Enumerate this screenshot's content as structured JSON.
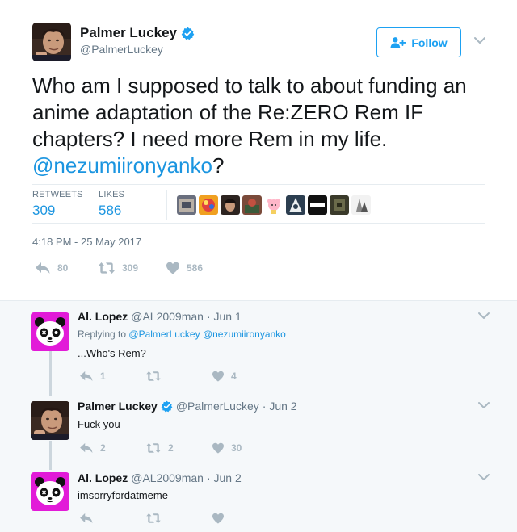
{
  "tweet": {
    "author_name": "Palmer Luckey",
    "author_handle": "@PalmerLuckey",
    "follow_label": "Follow",
    "text_part1": "Who am I supposed to talk to about funding an anime adaptation of the Re:ZERO Rem IF chapters? I need more Rem in my life. ",
    "mention": "@nezumiironyanko",
    "text_part2": "?",
    "retweets_label": "RETWEETS",
    "retweets_count": "309",
    "likes_label": "LIKES",
    "likes_count": "586",
    "timestamp": "4:18 PM - 25 May 2017",
    "reply_count": "80",
    "retweet_count_action": "309",
    "like_count_action": "586"
  },
  "replies": [
    {
      "name": "Al. Lopez",
      "handle": "@AL2009man",
      "date": "· Jun 1",
      "replying_prefix": "Replying to",
      "replying_to": "@PalmerLuckey @nezumiironyanko",
      "text": "...Who's Rem?",
      "reply_count": "1",
      "retweet_count": "",
      "like_count": "4"
    },
    {
      "name": "Palmer Luckey",
      "handle": "@PalmerLuckey",
      "date": "· Jun 2",
      "text": "Fuck you",
      "reply_count": "2",
      "retweet_count": "2",
      "like_count": "30"
    },
    {
      "name": "Al. Lopez",
      "handle": "@AL2009man",
      "date": "· Jun 2",
      "text": "imsorryfordatmeme",
      "reply_count": "",
      "retweet_count": "",
      "like_count": ""
    }
  ],
  "colors": {
    "brand_blue": "#1da1f2",
    "link_blue": "#1b95e0",
    "muted_gray": "#657786",
    "action_gray": "#aab8c2",
    "panda_magenta": "#e21bd8"
  },
  "icons": [
    "verified-badge-icon",
    "follow-user-icon",
    "chevron-down-icon",
    "reply-icon",
    "retweet-icon",
    "heart-icon"
  ]
}
